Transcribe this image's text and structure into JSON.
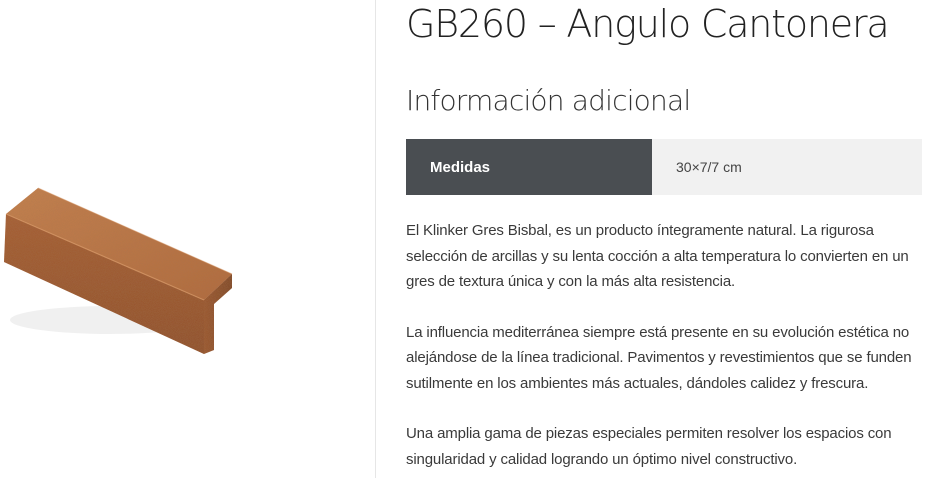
{
  "product": {
    "title": "GB260 – Angulo Cantonera",
    "image_alt": "Angulo Cantonera klinker piece"
  },
  "additional_info": {
    "heading": "Información adicional",
    "attributes": [
      {
        "label": "Medidas",
        "value": "30×7/7 cm"
      }
    ]
  },
  "description": {
    "paragraphs": [
      "El Klinker Gres Bisbal, es un producto íntegramente natural. La rigurosa selección de arcillas y su lenta cocción a alta temperatura lo convierten en un gres de textura única y con la más alta resistencia.",
      "La influencia mediterránea siempre está presente en su evolución estética no alejándose de la línea tradicional. Pavimentos y revestimientos que se funden sutilmente en los ambientes más actuales, dándoles calidez y frescura.",
      "Una amplia gama de piezas especiales permiten resolver los espacios con singularidad y calidad logrando un óptimo nivel constructivo."
    ]
  },
  "colors": {
    "tile_top": "#c1763f",
    "tile_front": "#9c5228",
    "tile_side": "#8a4722",
    "table_label_bg": "#4a4e52",
    "table_value_bg": "#f1f1f1"
  }
}
